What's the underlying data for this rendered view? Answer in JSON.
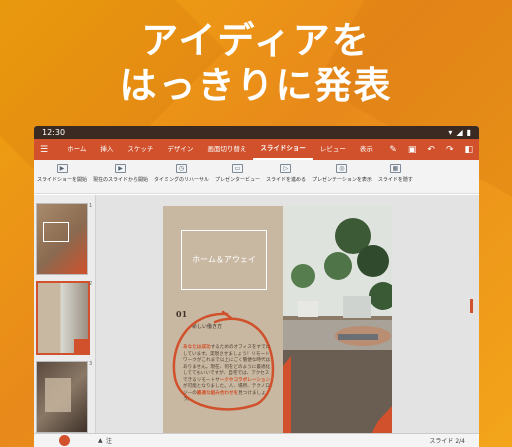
{
  "headline": {
    "line1": "アイディアを",
    "line2": "はっきりに発表"
  },
  "status": {
    "time": "12:30"
  },
  "appbar": {
    "tabs": [
      "ホーム",
      "挿入",
      "スケッチ",
      "デザイン",
      "画面切り替え",
      "スライドショー",
      "レビュー",
      "表示"
    ],
    "active_tab": "スライドショー"
  },
  "ribbon": {
    "items": [
      "スライドショーを開始",
      "現在のスライドから開始",
      "タイミングのリハーサル",
      "プレゼンタービュー",
      "スライドを進める",
      "プレゼンテーションを表示",
      "スライドを隠す"
    ]
  },
  "thumbs": {
    "nums": [
      "1",
      "2",
      "3"
    ]
  },
  "slide": {
    "title": "ホーム＆アウェイ",
    "num": "01",
    "subhead": "新しい働き方",
    "body_highlight": "あなたは成功",
    "body": "するためのオフィスをすでにしています。実現させましょう！リモートワークがこれまで以上にごく簡便な時代はありません。現在、何をどのように最適化しててもいいですが、自宅では、アクセスできるリモートサ",
    "body_bold": "ークやコラボレーション",
    "body2": "が可能となりました。人、場所、テクノロジーの",
    "body_bold2": "最適な組み合わせを",
    "body3": "見つけましょう。"
  },
  "bottom": {
    "notes": "注",
    "slide_counter": "スライド 2/4"
  }
}
